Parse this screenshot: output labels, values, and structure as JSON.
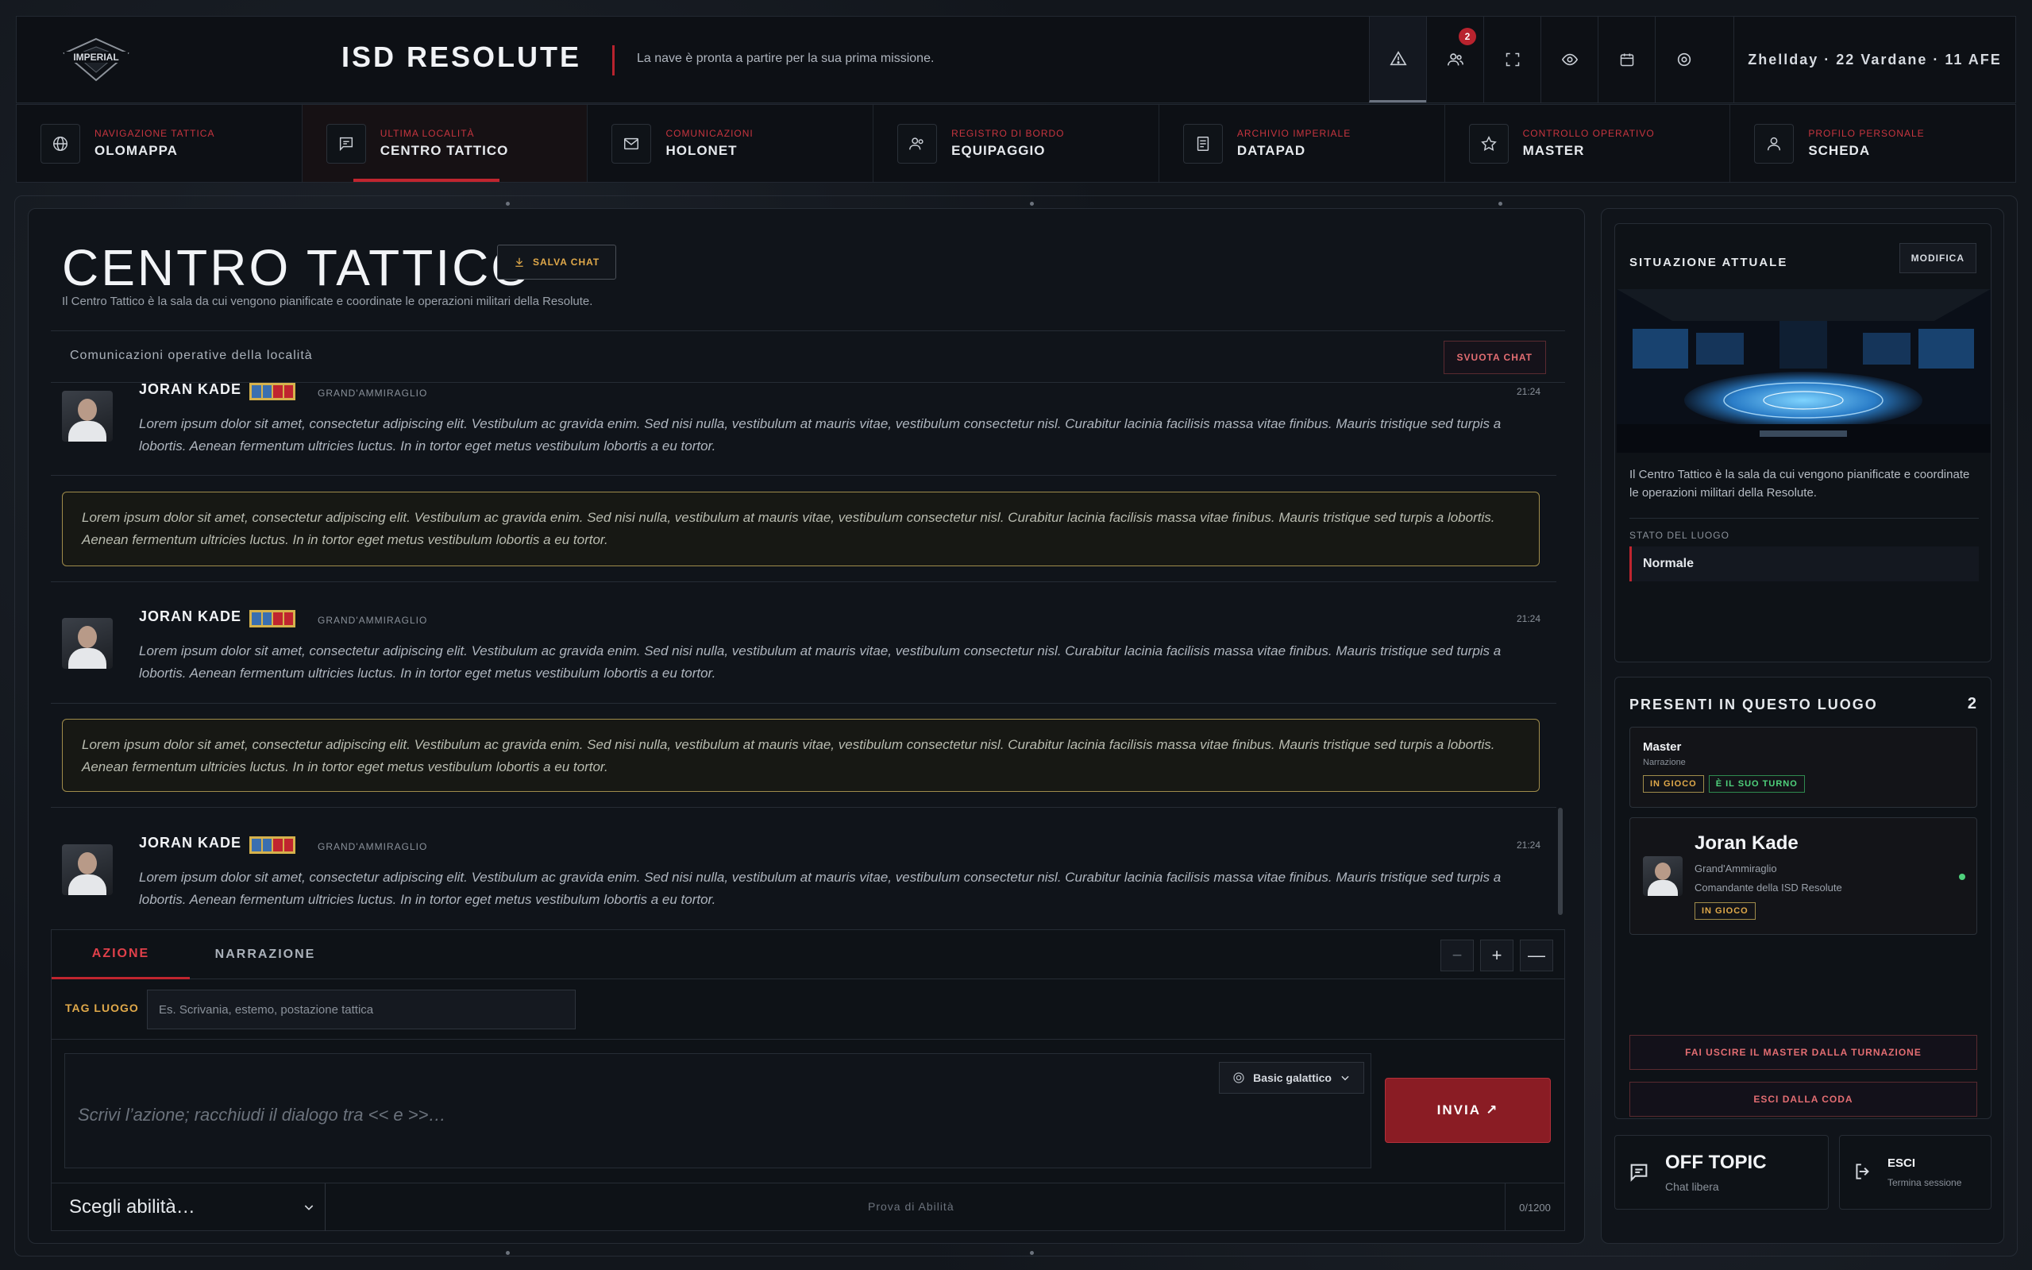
{
  "header": {
    "logo_text": "IMPERIAL",
    "ship_title": "ISD RESOLUTE",
    "subtitle": "La nave è pronta a partire per la sua prima missione.",
    "notification_badge": "2",
    "date": "Zhellday · 22 Vardane · 11 AFE",
    "icons": [
      "alert-icon",
      "users-icon",
      "fullscreen-icon",
      "eye-icon",
      "calendar-icon",
      "settings-icon"
    ]
  },
  "nav": [
    {
      "small": "NAVIGAZIONE TATTICA",
      "big": "OLOMAPPA",
      "icon": "globe-icon"
    },
    {
      "small": "ULTIMA LOCALITÀ",
      "big": "CENTRO TATTICO",
      "icon": "chat-icon"
    },
    {
      "small": "COMUNICAZIONI",
      "big": "HOLONET",
      "icon": "mail-icon"
    },
    {
      "small": "REGISTRO DI BORDO",
      "big": "EQUIPAGGIO",
      "icon": "users-icon"
    },
    {
      "small": "ARCHIVIO IMPERIALE",
      "big": "DATAPAD",
      "icon": "document-icon"
    },
    {
      "small": "CONTROLLO OPERATIVO",
      "big": "MASTER",
      "icon": "star-icon"
    },
    {
      "small": "PROFILO PERSONALE",
      "big": "SCHEDA",
      "icon": "user-icon"
    }
  ],
  "main": {
    "title": "CENTRO TATTICO",
    "save_label": "SALVA CHAT",
    "description": "Il Centro Tattico è la sala da cui vengono pianificate e coordinate le operazioni militari della Resolute.",
    "section_label": "Comunicazioni operative della località",
    "clear_label": "SVUOTA CHAT"
  },
  "messages": [
    {
      "name": "JORAN KADE",
      "rank": "GRAND'AMMIRAGLIO",
      "time": "21:24",
      "text": "Lorem ipsum dolor sit amet, consectetur adipiscing elit. Vestibulum ac gravida enim. Sed nisi nulla, vestibulum at mauris vitae, vestibulum consectetur nisl. Curabitur lacinia facilisis massa vitae finibus. Mauris tristique sed turpis a lobortis. Aenean fermentum ultricies luctus. In in tortor eget metus vestibulum lobortis a eu tortor."
    },
    {
      "narration": "Lorem ipsum dolor sit amet, consectetur adipiscing elit. Vestibulum ac gravida enim. Sed nisi nulla, vestibulum at mauris vitae, vestibulum consectetur nisl. Curabitur lacinia facilisis massa vitae finibus. Mauris tristique sed turpis a lobortis. Aenean fermentum ultricies luctus. In in tortor eget metus vestibulum lobortis a eu tortor."
    },
    {
      "name": "JORAN KADE",
      "rank": "GRAND'AMMIRAGLIO",
      "time": "21:24",
      "text": "Lorem ipsum dolor sit amet, consectetur adipiscing elit. Vestibulum ac gravida enim. Sed nisi nulla, vestibulum at mauris vitae, vestibulum consectetur nisl. Curabitur lacinia facilisis massa vitae finibus. Mauris tristique sed turpis a lobortis. Aenean fermentum ultricies luctus. In in tortor eget metus vestibulum lobortis a eu tortor."
    },
    {
      "narration": "Lorem ipsum dolor sit amet, consectetur adipiscing elit. Vestibulum ac gravida enim. Sed nisi nulla, vestibulum at mauris vitae, vestibulum consectetur nisl. Curabitur lacinia facilisis massa vitae finibus. Mauris tristique sed turpis a lobortis. Aenean fermentum ultricies luctus. In in tortor eget metus vestibulum lobortis a eu tortor."
    },
    {
      "name": "JORAN KADE",
      "rank": "GRAND'AMMIRAGLIO",
      "time": "21:24",
      "text": "Lorem ipsum dolor sit amet, consectetur adipiscing elit. Vestibulum ac gravida enim. Sed nisi nulla, vestibulum at mauris vitae, vestibulum consectetur nisl. Curabitur lacinia facilisis massa vitae finibus. Mauris tristique sed turpis a lobortis. Aenean fermentum ultricies luctus. In in tortor eget metus vestibulum lobortis a eu tortor."
    }
  ],
  "composer": {
    "tab_action": "AZIONE",
    "tab_narration": "NARRAZIONE",
    "ctl_minus": "−",
    "ctl_plus": "+",
    "ctl_collapse": "—",
    "tag_label": "TAG LUOGO",
    "tag_placeholder": "Es. Scrivania, estemo, postazione tattica",
    "text_placeholder": "Scrivi l’azione; racchiudi il dialogo tra << e >>…",
    "language": "Basic galattico",
    "send_label": "INVIA ↗",
    "ability_placeholder": "Scegli abilità…",
    "ability_hint": "Prova di Abilità",
    "counter": "0/1200"
  },
  "sidebar": {
    "situation_title": "SITUAZIONE ATTUALE",
    "edit_label": "MODIFICA",
    "situation_desc": "Il Centro Tattico è la sala da cui vengono pianificate e coordinate le operazioni militari della Resolute.",
    "state_label": "STATO DEL LUOGO",
    "state_value": "Normale",
    "present_title": "PRESENTI IN QUESTO LUOGO",
    "present_count": "2",
    "master_card": {
      "name": "Master",
      "role": "Narrazione",
      "badge1": "IN GIOCO",
      "badge2": "È IL SUO TURNO"
    },
    "player_card": {
      "name": "Joran Kade",
      "rank": "Grand'Ammiraglio",
      "title": "Comandante della ISD Resolute",
      "badge": "IN GIOCO"
    },
    "btn_master_out": "FAI USCIRE IL MASTER DALLA TURNAZIONE",
    "btn_exit_queue": "ESCI DALLA CODA",
    "off_topic_title": "OFF TOPIC",
    "off_topic_sub": "Chat libera",
    "exit_title": "ESCI",
    "exit_sub": "Termina sessione"
  },
  "colors": {
    "accent_red": "#c0252f",
    "gold": "#e0a94a",
    "online_green": "#4fd27c"
  }
}
